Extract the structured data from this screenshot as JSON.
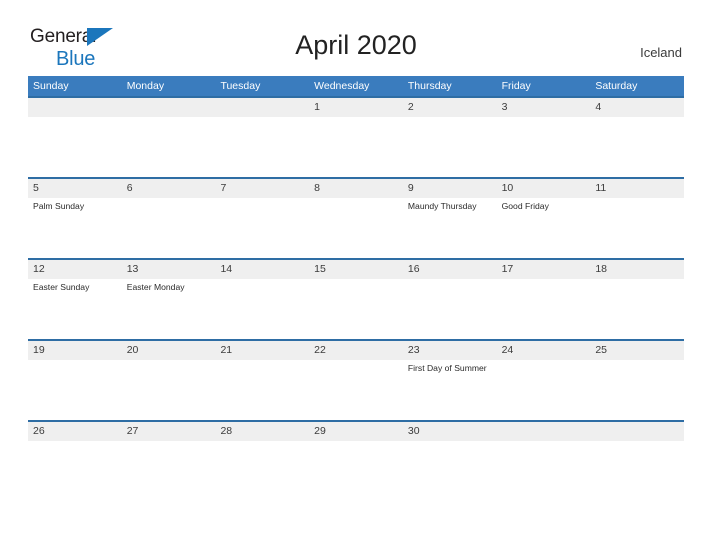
{
  "brand": {
    "name_part1": "General",
    "name_part2": "Blue",
    "triangle_color": "#1b76bc",
    "text_color": "#231f20"
  },
  "header": {
    "title": "April 2020",
    "location": "Iceland",
    "header_bg_color": "#3a7cbe",
    "row_border_color": "#2e6da4",
    "number_band_color": "#efefef"
  },
  "weekday_names": [
    "Sunday",
    "Monday",
    "Tuesday",
    "Wednesday",
    "Thursday",
    "Friday",
    "Saturday"
  ],
  "weeks": [
    {
      "days": [
        {
          "num": "",
          "event": ""
        },
        {
          "num": "",
          "event": ""
        },
        {
          "num": "",
          "event": ""
        },
        {
          "num": "1",
          "event": ""
        },
        {
          "num": "2",
          "event": ""
        },
        {
          "num": "3",
          "event": ""
        },
        {
          "num": "4",
          "event": ""
        }
      ]
    },
    {
      "days": [
        {
          "num": "5",
          "event": "Palm Sunday"
        },
        {
          "num": "6",
          "event": ""
        },
        {
          "num": "7",
          "event": ""
        },
        {
          "num": "8",
          "event": ""
        },
        {
          "num": "9",
          "event": "Maundy Thursday"
        },
        {
          "num": "10",
          "event": "Good Friday"
        },
        {
          "num": "11",
          "event": ""
        }
      ]
    },
    {
      "days": [
        {
          "num": "12",
          "event": "Easter Sunday"
        },
        {
          "num": "13",
          "event": "Easter Monday"
        },
        {
          "num": "14",
          "event": ""
        },
        {
          "num": "15",
          "event": ""
        },
        {
          "num": "16",
          "event": ""
        },
        {
          "num": "17",
          "event": ""
        },
        {
          "num": "18",
          "event": ""
        }
      ]
    },
    {
      "days": [
        {
          "num": "19",
          "event": ""
        },
        {
          "num": "20",
          "event": ""
        },
        {
          "num": "21",
          "event": ""
        },
        {
          "num": "22",
          "event": ""
        },
        {
          "num": "23",
          "event": "First Day of Summer"
        },
        {
          "num": "24",
          "event": ""
        },
        {
          "num": "25",
          "event": ""
        }
      ]
    },
    {
      "days": [
        {
          "num": "26",
          "event": ""
        },
        {
          "num": "27",
          "event": ""
        },
        {
          "num": "28",
          "event": ""
        },
        {
          "num": "29",
          "event": ""
        },
        {
          "num": "30",
          "event": ""
        },
        {
          "num": "",
          "event": ""
        },
        {
          "num": "",
          "event": ""
        }
      ]
    }
  ]
}
